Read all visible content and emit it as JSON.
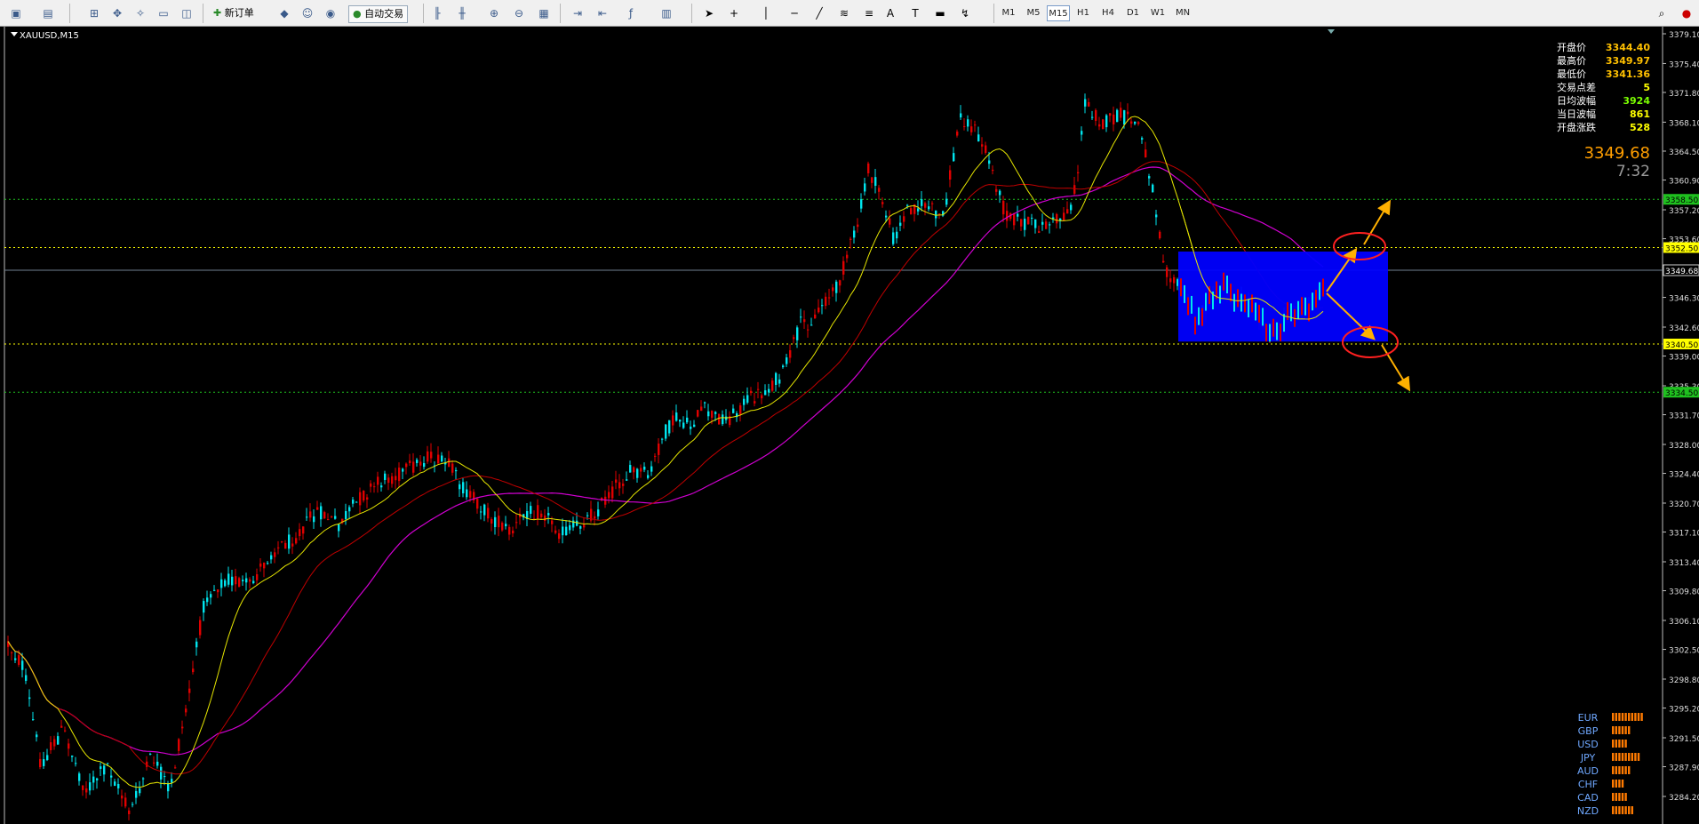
{
  "toolbar": {
    "new_order_label": "新订单",
    "auto_trade_label": "自动交易",
    "timeframes": [
      "M1",
      "M5",
      "M15",
      "H1",
      "H4",
      "D1",
      "W1",
      "MN"
    ],
    "active_timeframe": "M15"
  },
  "chart": {
    "symbol_label": "XAUUSD,M15",
    "price_axis_labels": [
      "3379.10",
      "3375.40",
      "3371.80",
      "3368.10",
      "3364.50",
      "3360.90",
      "3357.20",
      "3353.60",
      "3349.68",
      "3346.30",
      "3342.60",
      "3339.00",
      "3335.30",
      "3331.70",
      "3328.00",
      "3324.40",
      "3320.70",
      "3317.10",
      "3313.40",
      "3309.80",
      "3306.10",
      "3302.50",
      "3298.80",
      "3295.20",
      "3291.50",
      "3287.90",
      "3284.20"
    ],
    "horizontal_lines": [
      {
        "label": "3358.50",
        "color": "#1fc11f",
        "style": "green"
      },
      {
        "label": "3352.50",
        "color": "#ffff00",
        "style": "yellow"
      },
      {
        "label": "3340.50",
        "color": "#ffff00",
        "style": "yellow"
      },
      {
        "label": "3334.50",
        "color": "#1fc11f",
        "style": "green"
      }
    ],
    "current_price_label": "3349.68"
  },
  "info_panel": {
    "rows": [
      {
        "label": "开盘价",
        "value": "3344.40",
        "color": "#ffc000"
      },
      {
        "label": "最高价",
        "value": "3349.97",
        "color": "#ffc000"
      },
      {
        "label": "最低价",
        "value": "3341.36",
        "color": "#ffc000"
      },
      {
        "label": "交易点差",
        "value": "5",
        "color": "#ffff00"
      },
      {
        "label": "日均波幅",
        "value": "3924",
        "color": "#7cff00"
      },
      {
        "label": "当日波幅",
        "value": "861",
        "color": "#ffff00"
      },
      {
        "label": "开盘涨跌",
        "value": "528",
        "color": "#ffff00"
      }
    ],
    "big_price": "3349.68",
    "countdown": "7:32"
  },
  "currency_strength": [
    {
      "code": "EUR",
      "bars": 10
    },
    {
      "code": "GBP",
      "bars": 6
    },
    {
      "code": "USD",
      "bars": 5
    },
    {
      "code": "JPY",
      "bars": 9
    },
    {
      "code": "AUD",
      "bars": 6
    },
    {
      "code": "CHF",
      "bars": 4
    },
    {
      "code": "CAD",
      "bars": 5
    },
    {
      "code": "NZD",
      "bars": 7
    }
  ],
  "colors": {
    "bull": "#e00000",
    "bear": "#00e5ee",
    "ma_fast": "#e6e600",
    "ma_mid": "#c00000",
    "ma_slow": "#d000d0",
    "box": "#0000ff",
    "arrow": "#ffb000",
    "circle": "#ff2020"
  }
}
